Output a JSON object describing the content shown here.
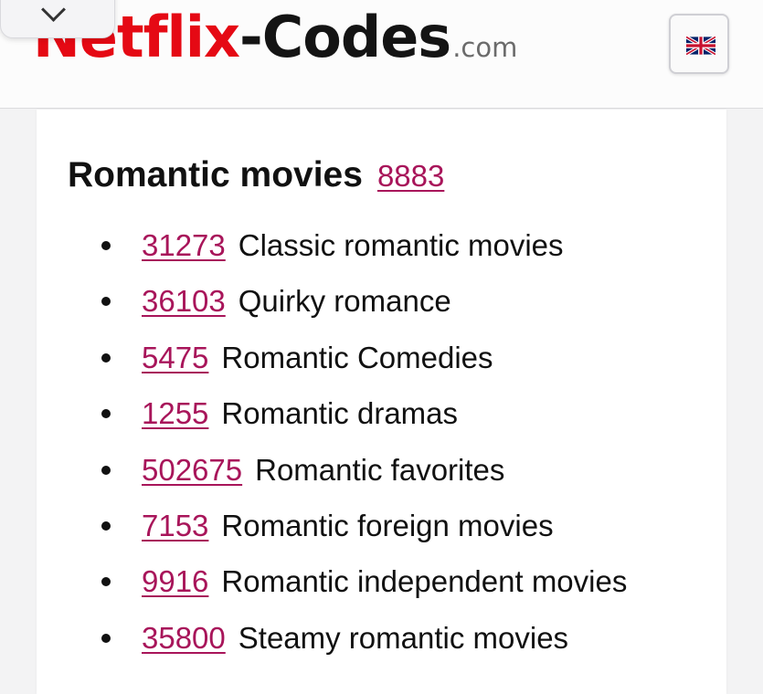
{
  "header": {
    "logo": {
      "netflix": "Netflix",
      "codes": "-Codes",
      "tld": ".com"
    },
    "collapse_tab_icon": "chevron-down-icon",
    "language_flag": "uk-flag-icon"
  },
  "section": {
    "title": "Romantic movies",
    "code": "8883",
    "items": [
      {
        "code": "31273",
        "label": "Classic romantic movies"
      },
      {
        "code": "36103",
        "label": "Quirky romance"
      },
      {
        "code": "5475",
        "label": "Romantic Comedies"
      },
      {
        "code": "1255",
        "label": "Romantic dramas"
      },
      {
        "code": "502675",
        "label": "Romantic favorites"
      },
      {
        "code": "7153",
        "label": "Romantic foreign movies"
      },
      {
        "code": "9916",
        "label": "Romantic independent movies"
      },
      {
        "code": "35800",
        "label": "Steamy romantic movies"
      }
    ]
  },
  "colors": {
    "brand_red": "#e50914",
    "link": "#a8155a",
    "text": "#111111"
  }
}
